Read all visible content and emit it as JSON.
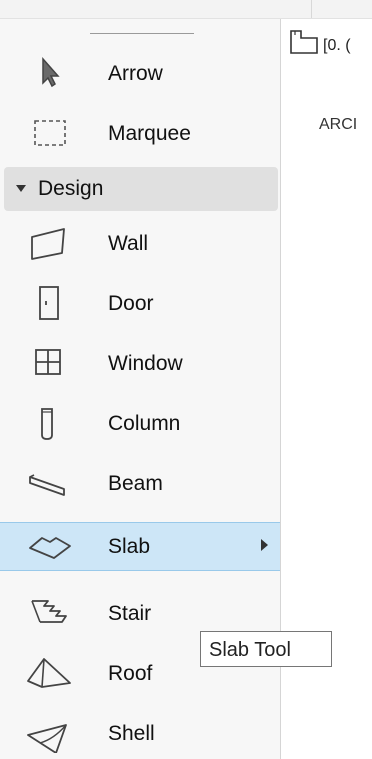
{
  "toolbox": {
    "tools_top": [
      {
        "label": "Arrow",
        "icon": "arrow-icon"
      },
      {
        "label": "Marquee",
        "icon": "marquee-icon"
      }
    ],
    "group": {
      "label": "Design",
      "expanded": true
    },
    "tools_design": [
      {
        "label": "Wall",
        "icon": "wall-icon"
      },
      {
        "label": "Door",
        "icon": "door-icon"
      },
      {
        "label": "Window",
        "icon": "window-icon"
      },
      {
        "label": "Column",
        "icon": "column-icon"
      },
      {
        "label": "Beam",
        "icon": "beam-icon"
      },
      {
        "label": "Slab",
        "icon": "slab-icon",
        "selected": true,
        "has_submenu": true
      },
      {
        "label": "Stair",
        "icon": "stair-icon"
      },
      {
        "label": "Roof",
        "icon": "roof-icon"
      },
      {
        "label": "Shell",
        "icon": "shell-icon"
      }
    ]
  },
  "view": {
    "name": "[0. (",
    "subtitle": "ARCI"
  },
  "tooltip": {
    "text": "Slab Tool"
  },
  "colors": {
    "selection_bg": "#cde6f7",
    "selection_border": "#99c9ea",
    "group_header_bg": "#e0e0e0"
  }
}
